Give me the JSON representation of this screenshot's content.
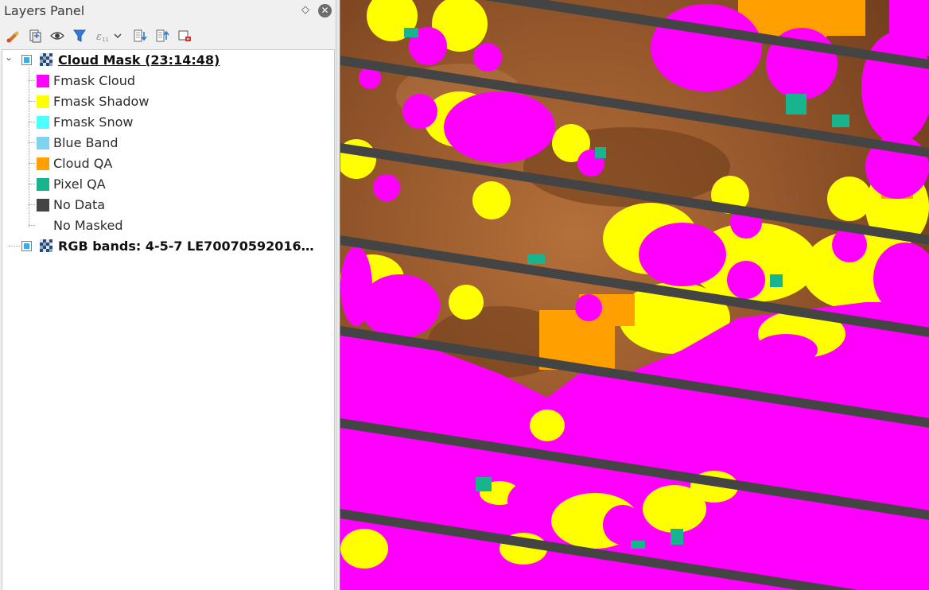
{
  "panel": {
    "title": "Layers Panel",
    "float_icon": "◇",
    "close_icon": "✕"
  },
  "toolbar": {
    "items": [
      "style-manager-icon",
      "add-group-icon",
      "visibility-eye-icon",
      "filter-legend-icon",
      "filter-expression-icon",
      "dropdown-arrow-icon",
      "expand-all-icon",
      "collapse-all-icon",
      "remove-layer-icon"
    ]
  },
  "layers": [
    {
      "name": "Cloud Mask (23:14:48)",
      "checked": true,
      "expanded": true,
      "legend": [
        {
          "label": "Fmask Cloud",
          "color": "#ff00ff"
        },
        {
          "label": "Fmask Shadow",
          "color": "#ffff00"
        },
        {
          "label": "Fmask Snow",
          "color": "#4dffff"
        },
        {
          "label": "Blue Band",
          "color": "#7dd3f0"
        },
        {
          "label": "Cloud QA",
          "color": "#ff9f00"
        },
        {
          "label": "Pixel QA",
          "color": "#18b48e"
        },
        {
          "label": "No Data",
          "color": "#444444"
        },
        {
          "label": "No Masked",
          "color": ""
        }
      ]
    },
    {
      "name": "RGB bands: 4-5-7 LE70070592016…",
      "checked": true,
      "expanded": false
    }
  ],
  "map": {
    "colors": {
      "background": "#9a5a2a",
      "cloud": "#ff00ff",
      "shadow": "#ffff00",
      "cloud_qa": "#ff9f00",
      "pixel_qa": "#18b48e",
      "no_data": "#444444"
    }
  }
}
